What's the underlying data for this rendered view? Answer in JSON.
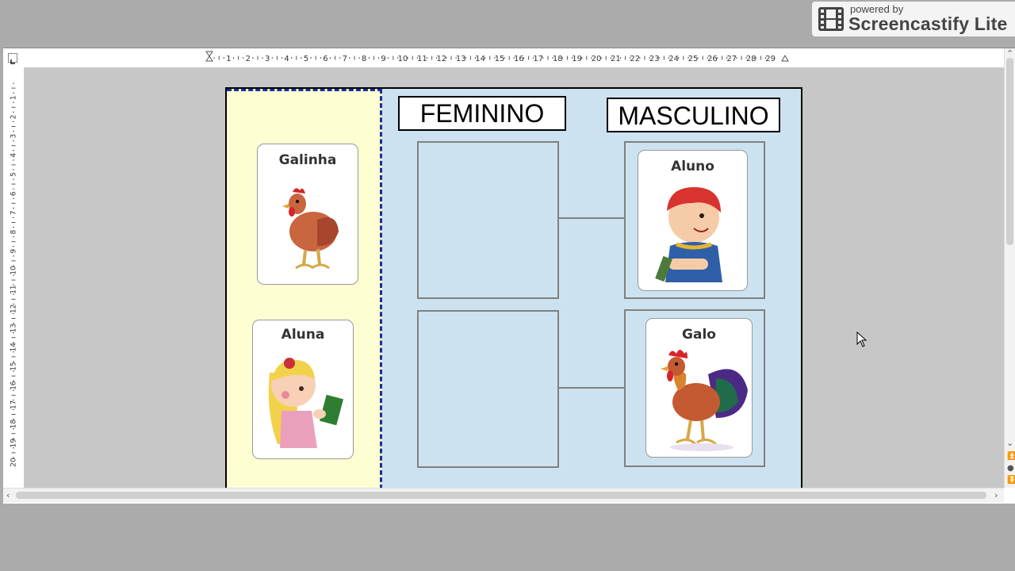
{
  "watermark": {
    "line1": "powered by",
    "line2": "Screencastify Lite"
  },
  "ruler": {
    "horizontal_marks": [
      "1",
      "2",
      "3",
      "4",
      "5",
      "6",
      "7",
      "8",
      "9",
      "10",
      "11",
      "12",
      "13",
      "14",
      "15",
      "16",
      "17",
      "18",
      "19",
      "20",
      "21",
      "22",
      "23",
      "24",
      "25",
      "26",
      "27",
      "28",
      "29"
    ],
    "vertical_marks": [
      "1",
      "2",
      "3",
      "4",
      "5",
      "6",
      "7",
      "8",
      "9",
      "10",
      "11",
      "12",
      "13",
      "14",
      "15",
      "16",
      "17",
      "18",
      "19",
      "20"
    ]
  },
  "worksheet": {
    "heading_feminine": "FEMININO",
    "heading_masculine": "MASCULINO",
    "cards": {
      "galinha": "Galinha",
      "aluna": "Aluna",
      "aluno": "Aluno",
      "galo": "Galo"
    }
  },
  "colors": {
    "page_background": "#cce2f0",
    "side_panel": "#fdfed2",
    "dashed_border": "#1a2f9a"
  }
}
